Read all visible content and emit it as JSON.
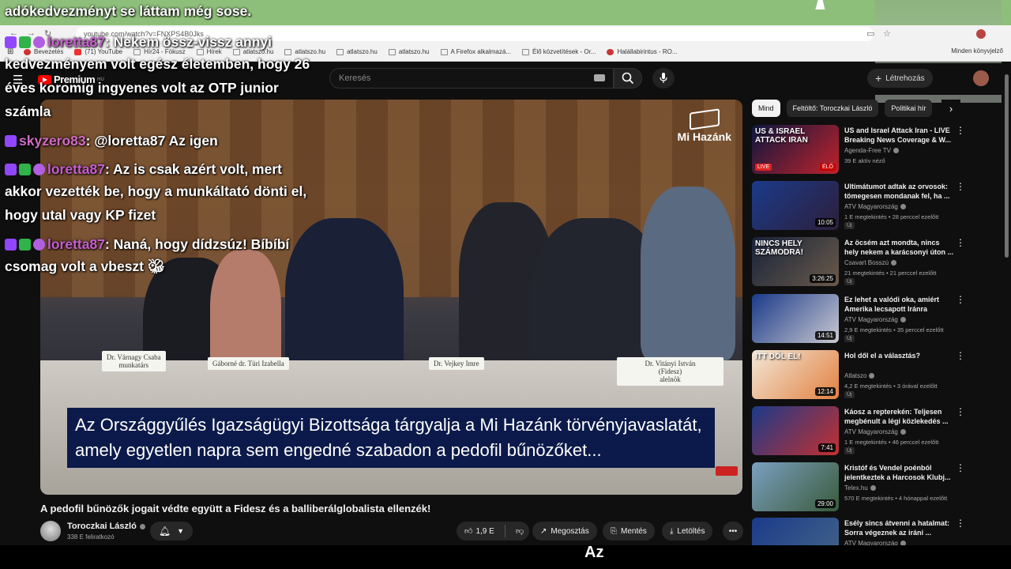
{
  "browser": {
    "url": "youtube.com/watch?v=FNXPS4B0Jks",
    "bookmarks": [
      {
        "label": "Bevezetés",
        "icon": "firefox-icon"
      },
      {
        "label": "(71) YouTube",
        "icon": "youtube-icon"
      },
      {
        "label": "Hír24 - Fókusz",
        "icon": "folder-icon"
      },
      {
        "label": "Hírek",
        "icon": "folder-icon"
      },
      {
        "label": "atlatszo.hu",
        "icon": "folder-icon"
      },
      {
        "label": "atlatszo.hu",
        "icon": "folder-icon"
      },
      {
        "label": "atlatszo.hu",
        "icon": "folder-icon"
      },
      {
        "label": "atlatszo.hu",
        "icon": "folder-icon"
      },
      {
        "label": "A Firefox alkalmazá...",
        "icon": "folder-icon"
      },
      {
        "label": "Élő közvetítések - Or...",
        "icon": "page-icon"
      },
      {
        "label": "Halállabirintus - RO...",
        "icon": "round-icon"
      }
    ],
    "bookmarks_right": "Minden könyvjelző"
  },
  "youtube": {
    "logo_text": "Premium",
    "logo_region": "HU",
    "search_placeholder": "Keresés",
    "create_label": "Létrehozás"
  },
  "video": {
    "title": "A pedofil bűnözők jogait védte együtt a Fidesz és a balliberálglobalista ellenzék!",
    "subtitle_line1": "Az Országgyűlés Igazságügyi Bizottsága tárgyalja a Mi Hazánk törvényjavaslatát,",
    "subtitle_line2": "amely egyetlen napra sem engedné szabadon a pedofil bűnözőket...",
    "watermark": "Mi Hazánk",
    "namecards": [
      "Dr. Várnagy Csaba",
      "Gáborné dr. Türi Izabella",
      "Dr. Vejkey Imre",
      "Dr. Vitányi István",
      "(Fidesz)",
      "alelnök",
      "munkatárs"
    ],
    "channel": {
      "name": "Toroczkai László",
      "subs": "338 E feliratkozó"
    },
    "actions": {
      "likes": "1,9 E",
      "share": "Megosztás",
      "save": "Mentés",
      "download": "Letöltés"
    }
  },
  "sidebar": {
    "chips": [
      "Mind",
      "Feltöltő: Toroczkai László",
      "Politikai hír"
    ],
    "recommendations": [
      {
        "title": "US and Israel Attack Iran - LIVE Breaking News Coverage & W...",
        "channel": "Agenda-Free TV",
        "meta": "39 E aktív néző",
        "duration": "",
        "badge": "",
        "thumb_text": "US & ISRAEL ATTACK IRAN",
        "thumb_live": "LIVE",
        "thumb_elo": "ÉLŐ",
        "colors": [
          "#0b1740",
          "#c0222b"
        ]
      },
      {
        "title": "Ultimátumot adtak az orvosok: tömegesen mondanak fel, ha ...",
        "channel": "ATV Magyarország",
        "meta": "1 E megtekintés • 28 perccel ezelőtt",
        "duration": "10:05",
        "badge": "Új",
        "thumb_text": "",
        "colors": [
          "#1b3a8a",
          "#2d1f3a"
        ]
      },
      {
        "title": "Az öcsém azt mondta, nincs hely nekem a karácsonyi úton ...",
        "channel": "Csavart Bosszú",
        "meta": "21 megtekintés • 21 perccel ezelőtt",
        "duration": "3:26:25",
        "badge": "Új",
        "thumb_text": "NINCS HELY SZÁMODRA!",
        "colors": [
          "#18233a",
          "#6a5a4a"
        ]
      },
      {
        "title": "Ez lehet a valódi oka, amiért Amerika lecsapott Iránra",
        "channel": "ATV Magyarország",
        "meta": "2,9 E megtekintés • 35 perccel ezelőtt",
        "duration": "14:51",
        "badge": "Új",
        "thumb_text": "",
        "colors": [
          "#1b3a8a",
          "#c9c9d0"
        ]
      },
      {
        "title": "Hol dől el a választás?",
        "channel": "Atlatszo",
        "meta": "4,2 E megtekintés • 3 órával ezelőtt",
        "duration": "12:14",
        "badge": "Új",
        "thumb_text": "ITT DŐL EL!",
        "colors": [
          "#f2e8d8",
          "#e28040"
        ]
      },
      {
        "title": "Káosz a repterekén: Teljesen megbénult a légi közlekedés ...",
        "channel": "ATV Magyarország",
        "meta": "1 E megtekintés • 46 perccel ezelőtt",
        "duration": "7:41",
        "badge": "Új",
        "thumb_text": "",
        "colors": [
          "#1b3a8a",
          "#c43030"
        ]
      },
      {
        "title": "Kristóf és Vendel poénból jelentkeztek a Harcosok Klubj...",
        "channel": "Telex.hu",
        "meta": "570 E megtekintés • 4 hónappal ezelőtt",
        "duration": "29:00",
        "badge": "",
        "thumb_text": "",
        "colors": [
          "#7aa0c0",
          "#3a5a3a"
        ]
      },
      {
        "title": "Esély sincs átvenni a hatalmat: Sorra végeznek az iráni ...",
        "channel": "ATV Magyarország",
        "meta": "",
        "duration": "",
        "badge": "",
        "thumb_text": "",
        "colors": [
          "#1b3a8a",
          "#446688"
        ]
      }
    ]
  },
  "chat": {
    "top_line": "adókedvezményt se láttam még sose.",
    "messages": [
      {
        "user": "loretta87",
        "text": ": Nekem össz-vissz annyi",
        "cont": [
          "kedvezményem volt egész életemben, hogy 26",
          "éves koromig ingyenes volt az OTP junior",
          "számla"
        ]
      },
      {
        "user": "skyzero83",
        "text": ": @loretta87 Az igen",
        "cont": []
      },
      {
        "user": "loretta87",
        "text": ": Az is csak azért volt, mert",
        "cont": [
          "akkor vezették be, hogy a munkáltató dönti el,",
          "hogy utal vagy KP fizet"
        ]
      },
      {
        "user": "loretta87",
        "text": ": Naná, hogy dídzsúz! Bíbíbí",
        "cont": [
          "csomag volt a vbeszt"
        ]
      }
    ]
  },
  "bottom_caption": "Az"
}
